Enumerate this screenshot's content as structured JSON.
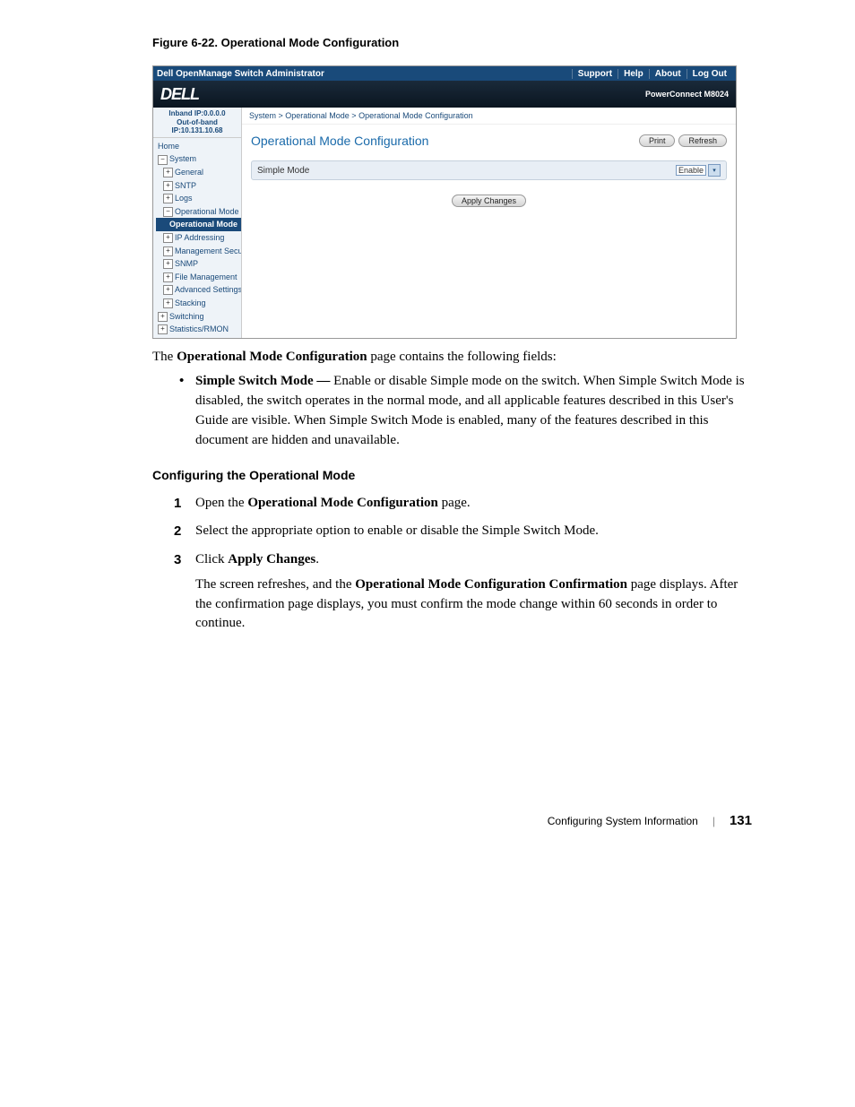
{
  "figure_caption": "Figure 6-22.    Operational Mode Configuration",
  "topbar": {
    "title": "Dell OpenManage Switch Administrator",
    "links": [
      "Support",
      "Help",
      "About",
      "Log Out"
    ]
  },
  "header": {
    "logo": "DELL",
    "product": "PowerConnect M8024"
  },
  "ip": {
    "inband": "Inband IP:0.0.0.0",
    "outband": "Out-of-band IP:10.131.10.68"
  },
  "tree": {
    "home": "Home",
    "system": "System",
    "general": "General",
    "sntp": "SNTP",
    "logs": "Logs",
    "op_mode": "Operational Mode",
    "op_mode_sel": "Operational Mode",
    "ip_addr": "IP Addressing",
    "mgmt_sec": "Management Security",
    "snmp": "SNMP",
    "file_mgmt": "File Management",
    "adv": "Advanced Settings",
    "stacking": "Stacking",
    "switching": "Switching",
    "stats": "Statistics/RMON"
  },
  "breadcrumb": "System > Operational Mode > Operational Mode Configuration",
  "content": {
    "title": "Operational Mode Configuration",
    "print": "Print",
    "refresh": "Refresh",
    "row_label": "Simple Mode",
    "row_value": "Enable",
    "apply": "Apply Changes"
  },
  "prose": {
    "intro_pre": "The ",
    "intro_bold": "Operational Mode Configuration",
    "intro_post": " page contains the following fields:",
    "bullet_bold": "Simple Switch Mode — ",
    "bullet_text": "Enable or disable Simple mode on the switch. When Simple Switch Mode is disabled, the switch operates in the normal mode, and all applicable features described in this User's Guide are visible. When Simple Switch Mode is enabled, many of the features described in this document are hidden and unavailable.",
    "subhead": "Configuring the Operational Mode",
    "step1_pre": "Open the ",
    "step1_bold": "Operational Mode Configuration",
    "step1_post": " page.",
    "step2": "Select the appropriate option to enable or disable the Simple Switch Mode.",
    "step3_pre": "Click ",
    "step3_bold": "Apply Changes",
    "step3_post": ".",
    "step3_para_pre": "The screen refreshes, and the ",
    "step3_para_bold": "Operational Mode Configuration Confirmation",
    "step3_para_post": " page displays. After the confirmation page displays, you must confirm the mode change within 60 seconds in order to continue."
  },
  "footer": {
    "section": "Configuring System Information",
    "page": "131"
  }
}
